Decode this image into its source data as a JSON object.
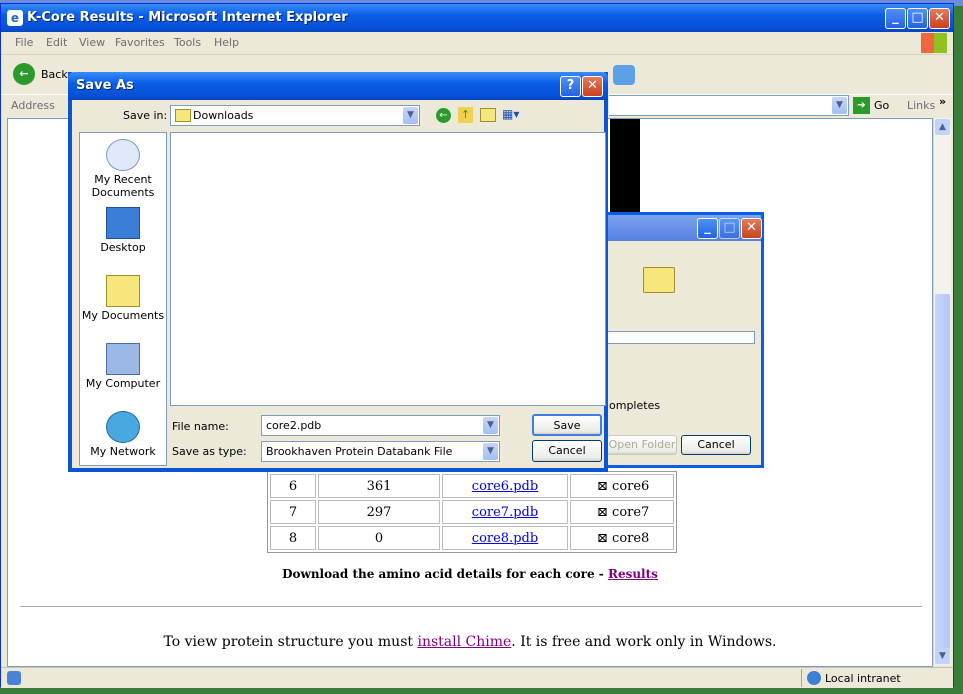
{
  "ie": {
    "title": "K-Core Results - Microsoft Internet Explorer",
    "menu": [
      "File",
      "Edit",
      "View",
      "Favorites",
      "Tools",
      "Help"
    ],
    "back_label": "Back",
    "address_label": "Address",
    "go_label": "Go",
    "links_label": "Links",
    "status_zone": "Local intranet"
  },
  "page": {
    "table_rows": [
      {
        "core": "6",
        "count": "361",
        "file": "core6.pdb",
        "view": "core6"
      },
      {
        "core": "7",
        "count": "297",
        "file": "core7.pdb",
        "view": "core7"
      },
      {
        "core": "8",
        "count": "0",
        "file": "core8.pdb",
        "view": "core8"
      }
    ],
    "download_text": "Download the amino acid details for each core - ",
    "download_link": "Results",
    "chime_prefix": "To view protein structure you must ",
    "chime_link": "install Chime",
    "chime_suffix": ". It is free and work only in Windows."
  },
  "download_dialog": {
    "partial_text": "ompletes",
    "open_folder_label": "Open Folder",
    "cancel_label": "Cancel"
  },
  "save_as": {
    "title": "Save As",
    "save_in_label": "Save in:",
    "save_in_value": "Downloads",
    "places": [
      "My Recent Documents",
      "Desktop",
      "My Documents",
      "My Computer",
      "My Network"
    ],
    "file_name_label": "File name:",
    "file_name_value": "core2.pdb",
    "save_type_label": "Save as type:",
    "save_type_value": "Brookhaven Protein Databank File",
    "save_button": "Save",
    "cancel_button": "Cancel"
  }
}
